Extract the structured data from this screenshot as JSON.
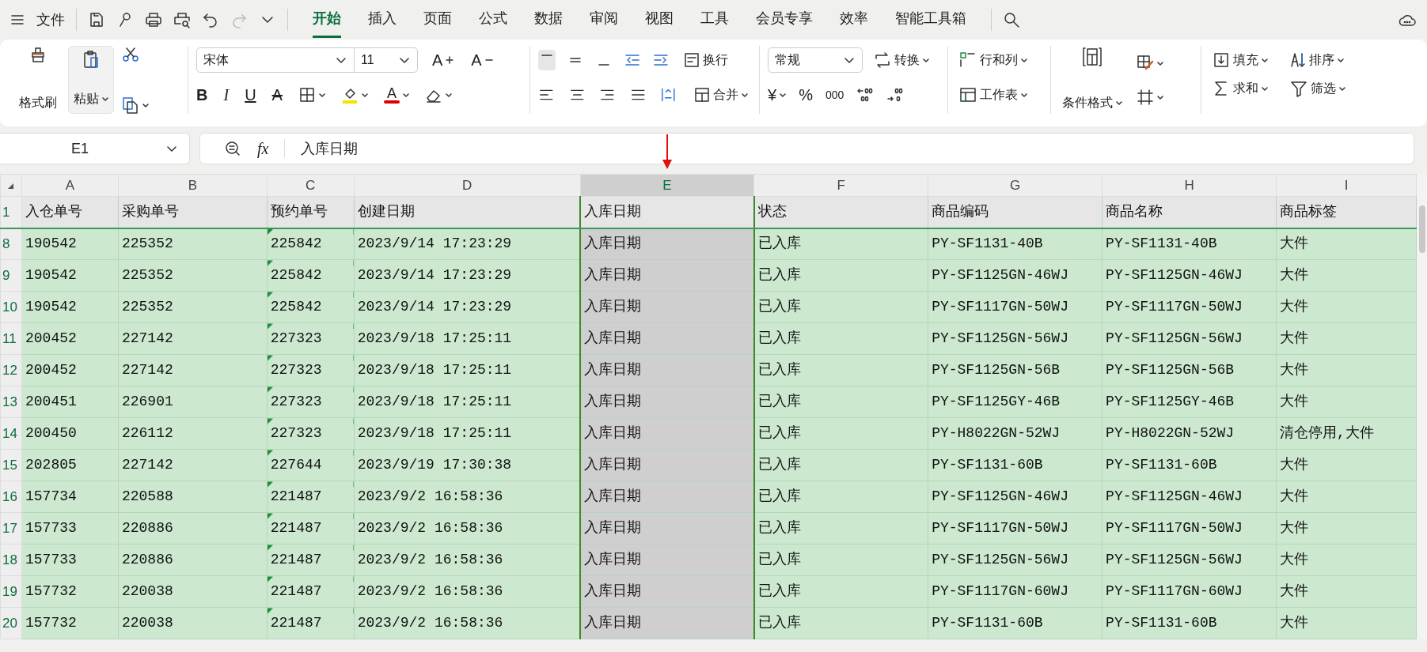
{
  "menu": {
    "file": "文件",
    "redo_disabled": true,
    "tabs": [
      {
        "label": "开始",
        "selected": true
      },
      {
        "label": "插入",
        "selected": false
      },
      {
        "label": "页面",
        "selected": false
      },
      {
        "label": "公式",
        "selected": false
      },
      {
        "label": "数据",
        "selected": false
      },
      {
        "label": "审阅",
        "selected": false
      },
      {
        "label": "视图",
        "selected": false
      },
      {
        "label": "工具",
        "selected": false
      },
      {
        "label": "会员专享",
        "selected": false
      },
      {
        "label": "效率",
        "selected": false
      },
      {
        "label": "智能工具箱",
        "selected": false
      }
    ]
  },
  "ribbon": {
    "format_painter": "格式刷",
    "paste": "粘贴",
    "font_name": "宋体",
    "font_size": "11",
    "grow_font": "A",
    "shrink_font": "A",
    "bold": "B",
    "italic": "I",
    "underline": "U",
    "strikethrough": "A",
    "font_color": "A",
    "vertical_align": [
      {
        "selected": true
      },
      {
        "selected": false
      },
      {
        "selected": false
      }
    ],
    "wrap": "换行",
    "merge": "合并",
    "number_format": "常规",
    "convert": "转换",
    "currency": "¥",
    "percent": "%",
    "thousands": "000",
    "rows_columns": "行和列",
    "worksheet": "工作表",
    "conditional_format": "条件格式",
    "fill": "填充",
    "sort": "排序",
    "sum": "求和",
    "filter": "筛选"
  },
  "formula_bar": {
    "name_box": "E1",
    "fx": "fx",
    "formula": "入库日期"
  },
  "sheet": {
    "columns": [
      {
        "label": "A",
        "selected": false
      },
      {
        "label": "B",
        "selected": false
      },
      {
        "label": "C",
        "selected": false
      },
      {
        "label": "D",
        "selected": false
      },
      {
        "label": "E",
        "selected": true
      },
      {
        "label": "F",
        "selected": false
      },
      {
        "label": "G",
        "selected": false
      },
      {
        "label": "H",
        "selected": false
      },
      {
        "label": "I",
        "selected": false
      }
    ],
    "rows": [
      {
        "number": "1",
        "header": true,
        "flag": false,
        "cells": [
          "入仓单号",
          "采购单号",
          "预约单号",
          "创建日期",
          "入库日期",
          "状态",
          "商品编码",
          "商品名称",
          "商品标签"
        ]
      },
      {
        "number": "8",
        "header": false,
        "flag": true,
        "cells": [
          "190542",
          "225352",
          "225842",
          "2023/9/14 17:23:29",
          "入库日期",
          "已入库",
          "PY-SF1131-40B",
          "PY-SF1131-40B",
          "大件"
        ]
      },
      {
        "number": "9",
        "header": false,
        "flag": true,
        "cells": [
          "190542",
          "225352",
          "225842",
          "2023/9/14 17:23:29",
          "入库日期",
          "已入库",
          "PY-SF1125GN-46WJ",
          "PY-SF1125GN-46WJ",
          "大件"
        ]
      },
      {
        "number": "10",
        "header": false,
        "flag": true,
        "cells": [
          "190542",
          "225352",
          "225842",
          "2023/9/14 17:23:29",
          "入库日期",
          "已入库",
          "PY-SF1117GN-50WJ",
          "PY-SF1117GN-50WJ",
          "大件"
        ]
      },
      {
        "number": "11",
        "header": false,
        "flag": true,
        "cells": [
          "200452",
          "227142",
          "227323",
          "2023/9/18 17:25:11",
          "入库日期",
          "已入库",
          "PY-SF1125GN-56WJ",
          "PY-SF1125GN-56WJ",
          "大件"
        ]
      },
      {
        "number": "12",
        "header": false,
        "flag": true,
        "cells": [
          "200452",
          "227142",
          "227323",
          "2023/9/18 17:25:11",
          "入库日期",
          "已入库",
          "PY-SF1125GN-56B",
          "PY-SF1125GN-56B",
          "大件"
        ]
      },
      {
        "number": "13",
        "header": false,
        "flag": true,
        "cells": [
          "200451",
          "226901",
          "227323",
          "2023/9/18 17:25:11",
          "入库日期",
          "已入库",
          "PY-SF1125GY-46B",
          "PY-SF1125GY-46B",
          "大件"
        ]
      },
      {
        "number": "14",
        "header": false,
        "flag": true,
        "cells": [
          "200450",
          "226112",
          "227323",
          "2023/9/18 17:25:11",
          "入库日期",
          "已入库",
          "PY-H8022GN-52WJ",
          "PY-H8022GN-52WJ",
          "清仓停用,大件"
        ]
      },
      {
        "number": "15",
        "header": false,
        "flag": true,
        "cells": [
          "202805",
          "227142",
          "227644",
          "2023/9/19 17:30:38",
          "入库日期",
          "已入库",
          "PY-SF1131-60B",
          "PY-SF1131-60B",
          "大件"
        ]
      },
      {
        "number": "16",
        "header": false,
        "flag": true,
        "cells": [
          "157734",
          "220588",
          "221487",
          "2023/9/2 16:58:36",
          "入库日期",
          "已入库",
          "PY-SF1125GN-46WJ",
          "PY-SF1125GN-46WJ",
          "大件"
        ]
      },
      {
        "number": "17",
        "header": false,
        "flag": true,
        "cells": [
          "157733",
          "220886",
          "221487",
          "2023/9/2 16:58:36",
          "入库日期",
          "已入库",
          "PY-SF1117GN-50WJ",
          "PY-SF1117GN-50WJ",
          "大件"
        ]
      },
      {
        "number": "18",
        "header": false,
        "flag": true,
        "cells": [
          "157733",
          "220886",
          "221487",
          "2023/9/2 16:58:36",
          "入库日期",
          "已入库",
          "PY-SF1125GN-56WJ",
          "PY-SF1125GN-56WJ",
          "大件"
        ]
      },
      {
        "number": "19",
        "header": false,
        "flag": true,
        "cells": [
          "157732",
          "220038",
          "221487",
          "2023/9/2 16:58:36",
          "入库日期",
          "已入库",
          "PY-SF1117GN-60WJ",
          "PY-SF1117GN-60WJ",
          "大件"
        ]
      },
      {
        "number": "20",
        "header": false,
        "flag": true,
        "cells": [
          "157732",
          "220038",
          "221487",
          "2023/9/2 16:58:36",
          "入库日期",
          "已入库",
          "PY-SF1131-60B",
          "PY-SF1131-60B",
          "大件"
        ]
      }
    ]
  }
}
